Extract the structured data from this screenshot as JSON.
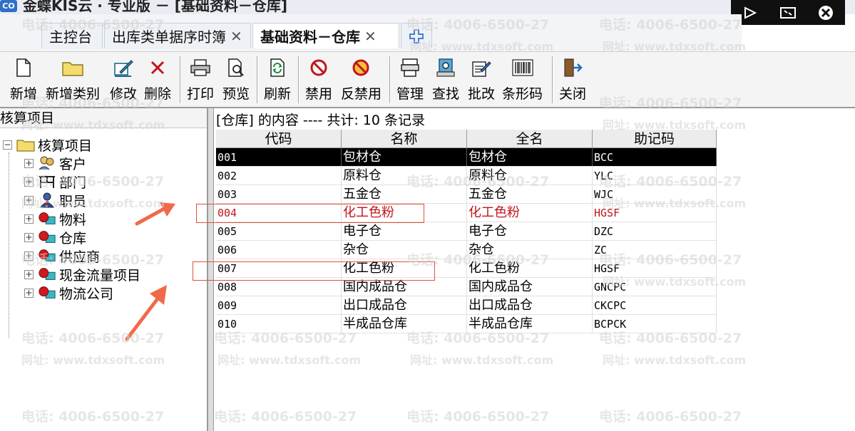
{
  "window": {
    "logo_text": "CO",
    "title": "金蝶KIS云 · 专业版 － [基础资料－仓库]"
  },
  "tabs": [
    {
      "label": "主控台",
      "closable": false,
      "active": false
    },
    {
      "label": "出库类单据序时簿",
      "closable": true,
      "active": false
    },
    {
      "label": "基础资料－仓库",
      "closable": true,
      "active": true
    }
  ],
  "toolbar": {
    "buttons": [
      {
        "label": "新增",
        "icon": "new-document-icon"
      },
      {
        "label": "新增类别",
        "icon": "folder-icon"
      },
      {
        "label": "修改",
        "icon": "edit-icon"
      },
      {
        "label": "删除",
        "icon": "delete-icon"
      },
      {
        "label": "打印",
        "icon": "printer-icon"
      },
      {
        "label": "预览",
        "icon": "preview-icon"
      },
      {
        "label": "刷新",
        "icon": "refresh-icon"
      },
      {
        "label": "禁用",
        "icon": "ban-icon"
      },
      {
        "label": "反禁用",
        "icon": "unban-icon"
      },
      {
        "label": "管理",
        "icon": "manage-icon"
      },
      {
        "label": "查找",
        "icon": "find-icon"
      },
      {
        "label": "批改",
        "icon": "batch-edit-icon"
      },
      {
        "label": "条形码",
        "icon": "barcode-icon"
      },
      {
        "label": "关闭",
        "icon": "exit-icon"
      }
    ]
  },
  "left_panel": {
    "header": "核算项目",
    "root": "核算项目",
    "items": [
      {
        "label": "客户",
        "icon": "customer-icon"
      },
      {
        "label": "部门",
        "icon": "department-icon"
      },
      {
        "label": "职员",
        "icon": "employee-icon"
      },
      {
        "label": "物料",
        "icon": "item-icon"
      },
      {
        "label": "仓库",
        "icon": "warehouse-icon"
      },
      {
        "label": "供应商",
        "icon": "supplier-icon"
      },
      {
        "label": "现金流量项目",
        "icon": "cashflow-icon"
      },
      {
        "label": "物流公司",
        "icon": "logistics-icon"
      }
    ]
  },
  "content": {
    "header": "[仓库] 的内容 ---- 共计: 10 条记录",
    "columns": [
      "代码",
      "名称",
      "全名",
      "助记码"
    ],
    "rows": [
      {
        "code": "001",
        "name": "包材仓",
        "full_name": "包材仓",
        "mnemonic": "BCC"
      },
      {
        "code": "002",
        "name": "原料仓",
        "full_name": "原料仓",
        "mnemonic": "YLC"
      },
      {
        "code": "003",
        "name": "五金仓",
        "full_name": "五金仓",
        "mnemonic": "WJC"
      },
      {
        "code": "004",
        "name": "化工色粉",
        "full_name": "化工色粉",
        "mnemonic": "HGSF"
      },
      {
        "code": "005",
        "name": "电子仓",
        "full_name": "电子仓",
        "mnemonic": "DZC"
      },
      {
        "code": "006",
        "name": "杂仓",
        "full_name": "杂仓",
        "mnemonic": "ZC"
      },
      {
        "code": "007",
        "name": "化工色粉",
        "full_name": "化工色粉",
        "mnemonic": "HGSF"
      },
      {
        "code": "008",
        "name": "国内成品仓",
        "full_name": "国内成品仓",
        "mnemonic": "GNCPC"
      },
      {
        "code": "009",
        "name": "出口成品仓",
        "full_name": "出口成品仓",
        "mnemonic": "CKCPC"
      },
      {
        "code": "010",
        "name": "半成品仓库",
        "full_name": "半成品仓库",
        "mnemonic": "BCPCK"
      }
    ]
  },
  "watermark": {
    "phone": "电话: 4006-6500-27",
    "site": "网址: www.tdxsoft.com"
  },
  "colors": {
    "annotation": "#e2503a",
    "disabled_row_text": "#c0151c",
    "selected_row_bg": "#000000"
  }
}
